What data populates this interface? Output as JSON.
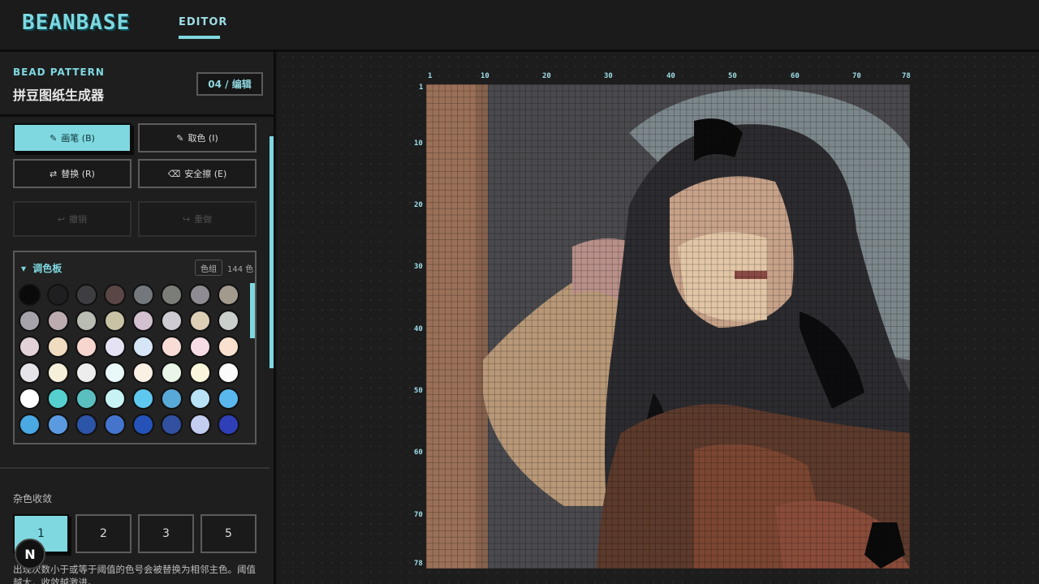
{
  "app": {
    "logo": "BEANBASE",
    "nav_editor": "EDITOR"
  },
  "header": {
    "title": "BEAD PATTERN",
    "subtitle": "拼豆图纸生成器",
    "step": "04 / 编辑"
  },
  "tools": {
    "brush": "画笔 (B)",
    "picker": "取色 (I)",
    "replace": "替换 (R)",
    "eraser": "安全擦 (E)",
    "undo": "撤销",
    "redo": "重做"
  },
  "palette": {
    "title": "调色板",
    "group_button": "色组",
    "count": "144 色",
    "colors": [
      "#0a0a0a",
      "#1f1f22",
      "#3e3e42",
      "#5b4646",
      "#73787c",
      "#7b7d78",
      "#8e8c92",
      "#a39a8e",
      "#a6a4aa",
      "#bcacb0",
      "#b9bcb3",
      "#c9c3a6",
      "#d4c1cf",
      "#cfcbd2",
      "#dccfb6",
      "#cbcfcc",
      "#e3d2d7",
      "#f0dcc0",
      "#f7d6cf",
      "#e5e3f3",
      "#d6e6f7",
      "#f8ddd6",
      "#f7dce5",
      "#f8e2cf",
      "#e6e4e8",
      "#f6efd9",
      "#ededed",
      "#e9f8f9",
      "#faf0e3",
      "#eaf7e8",
      "#f9f6dc",
      "#fbfbfb",
      "#ffffff",
      "#56cfcf",
      "#5bbfbf",
      "#c8f3f5",
      "#5fc8ef",
      "#59a9d8",
      "#b9e2f6",
      "#5ab7ee",
      "#4aa8e3",
      "#5b9ae0",
      "#2c54a8",
      "#4574cc",
      "#2452b8",
      "#3150a0",
      "#c3cdf0",
      "#2f3fb7"
    ]
  },
  "noise": {
    "label": "杂色收敛",
    "options": [
      "1",
      "2",
      "3",
      "5"
    ],
    "hint": "出现次数小于或等于阈值的色号会被替换为相邻主色。阈值越大，收敛越激进。"
  },
  "badge": "N",
  "ruler": {
    "top": [
      "1",
      "10",
      "20",
      "30",
      "40",
      "50",
      "60",
      "70",
      "78"
    ],
    "left": [
      "1",
      "10",
      "20",
      "30",
      "40",
      "50",
      "60",
      "70",
      "78"
    ]
  },
  "grid": {
    "columns": 78,
    "rows": 78
  }
}
